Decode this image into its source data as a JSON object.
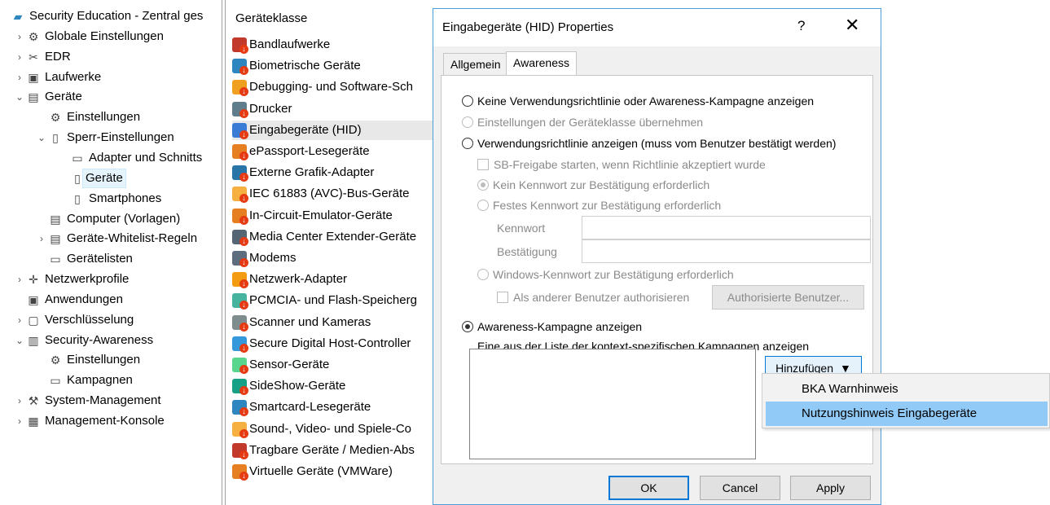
{
  "tree": {
    "items": [
      {
        "label": "Security Education - Zentral ges",
        "icon": "console-root-icon",
        "expander": ""
      },
      {
        "label": "Globale Einstellungen",
        "icon": "gear-globe-icon",
        "expander": "›"
      },
      {
        "label": "EDR",
        "icon": "tools-icon",
        "expander": "›"
      },
      {
        "label": "Laufwerke",
        "icon": "drive-icon",
        "expander": "›"
      },
      {
        "label": "Geräte",
        "icon": "devices-icon",
        "expander": "⌄"
      },
      {
        "label": "Einstellungen",
        "icon": "gear-icon",
        "expander": ""
      },
      {
        "label": "Sperr-Einstellungen",
        "icon": "lock-device-icon",
        "expander": "⌄"
      },
      {
        "label": "Adapter und Schnitts",
        "icon": "adapter-icon",
        "expander": ""
      },
      {
        "label": "Geräte",
        "icon": "device-icon",
        "expander": ""
      },
      {
        "label": "Smartphones",
        "icon": "smartphone-icon",
        "expander": ""
      },
      {
        "label": "Computer (Vorlagen)",
        "icon": "computer-icon",
        "expander": ""
      },
      {
        "label": "Geräte-Whitelist-Regeln",
        "icon": "whitelist-icon",
        "expander": "›"
      },
      {
        "label": "Gerätelisten",
        "icon": "list-icon",
        "expander": ""
      },
      {
        "label": "Netzwerkprofile",
        "icon": "network-icon",
        "expander": "›"
      },
      {
        "label": "Anwendungen",
        "icon": "application-icon",
        "expander": ""
      },
      {
        "label": "Verschlüsselung",
        "icon": "encryption-lock-icon",
        "expander": "›"
      },
      {
        "label": "Security-Awareness",
        "icon": "awareness-icon",
        "expander": "⌄"
      },
      {
        "label": "Einstellungen",
        "icon": "gear-icon",
        "expander": ""
      },
      {
        "label": "Kampagnen",
        "icon": "campaign-icon",
        "expander": ""
      },
      {
        "label": "System-Management",
        "icon": "system-management-icon",
        "expander": "›"
      },
      {
        "label": "Management-Konsole",
        "icon": "management-console-icon",
        "expander": "›"
      }
    ]
  },
  "list": {
    "header": "Geräteklasse",
    "items": [
      {
        "label": "Bandlaufwerke",
        "color": "#c0392b"
      },
      {
        "label": "Biometrische Geräte",
        "color": "#2e86c1"
      },
      {
        "label": "Debugging- und Software-Sch",
        "color": "#f0a020"
      },
      {
        "label": "Drucker",
        "color": "#607d8b"
      },
      {
        "label": "Eingabegeräte (HID)",
        "color": "#3a7bd5"
      },
      {
        "label": "ePassport-Lesegeräte",
        "color": "#e67e22"
      },
      {
        "label": "Externe Grafik-Adapter",
        "color": "#2874a6"
      },
      {
        "label": "IEC 61883 (AVC)-Bus-Geräte",
        "color": "#f5b041"
      },
      {
        "label": "In-Circuit-Emulator-Geräte",
        "color": "#e67e22"
      },
      {
        "label": "Media Center Extender-Geräte",
        "color": "#566573"
      },
      {
        "label": "Modems",
        "color": "#5d6d7e"
      },
      {
        "label": "Netzwerk-Adapter",
        "color": "#f39c12"
      },
      {
        "label": "PCMCIA- und Flash-Speicherg",
        "color": "#45b39d"
      },
      {
        "label": "Scanner und Kameras",
        "color": "#7f8c8d"
      },
      {
        "label": "Secure Digital Host-Controller",
        "color": "#3498db"
      },
      {
        "label": "Sensor-Geräte",
        "color": "#58d68d"
      },
      {
        "label": "SideShow-Geräte",
        "color": "#16a085"
      },
      {
        "label": "Smartcard-Lesegeräte",
        "color": "#2e86c1"
      },
      {
        "label": "Sound-, Video- und Spiele-Co",
        "color": "#f5b041"
      },
      {
        "label": "Tragbare Geräte / Medien-Abs",
        "color": "#c0392b"
      },
      {
        "label": "Virtuelle Geräte (VMWare)",
        "color": "#e67e22"
      }
    ]
  },
  "dialog": {
    "title": "Eingabegeräte (HID) Properties",
    "help": "?",
    "close": "✕",
    "tabs": [
      "Allgemein",
      "Awareness"
    ],
    "options": {
      "none": "Keine Verwendungsrichtlinie oder Awareness-Kampagne anzeigen",
      "inherit": "Einstellungen der Geräteklasse übernehmen",
      "policy": "Verwendungsrichtlinie anzeigen (muss vom Benutzer bestätigt werden)",
      "sb_release": "SB-Freigabe starten, wenn Richtlinie akzeptiert wurde",
      "no_password": "Kein Kennwort zur Bestätigung erforderlich",
      "fixed_password": "Festes Kennwort zur Bestätigung erforderlich",
      "password_label": "Kennwort",
      "confirm_label": "Bestätigung",
      "windows_password": "Windows-Kennwort zur Bestätigung erforderlich",
      "other_user": "Als anderer Benutzer authorisieren",
      "authorized_users_button": "Authorisierte Benutzer...",
      "campaign": "Awareness-Kampagne anzeigen",
      "campaign_desc": "Eine aus der Liste der kontext-spezifischen Kampagnen anzeigen"
    },
    "add_button": "Hinzufügen",
    "add_arrow": "▼",
    "buttons": {
      "ok": "OK",
      "cancel": "Cancel",
      "apply": "Apply"
    }
  },
  "dropdown": {
    "items": [
      "BKA Warnhinweis",
      "Nutzungshinweis Eingabegeräte"
    ],
    "highlighted_index": 1
  }
}
